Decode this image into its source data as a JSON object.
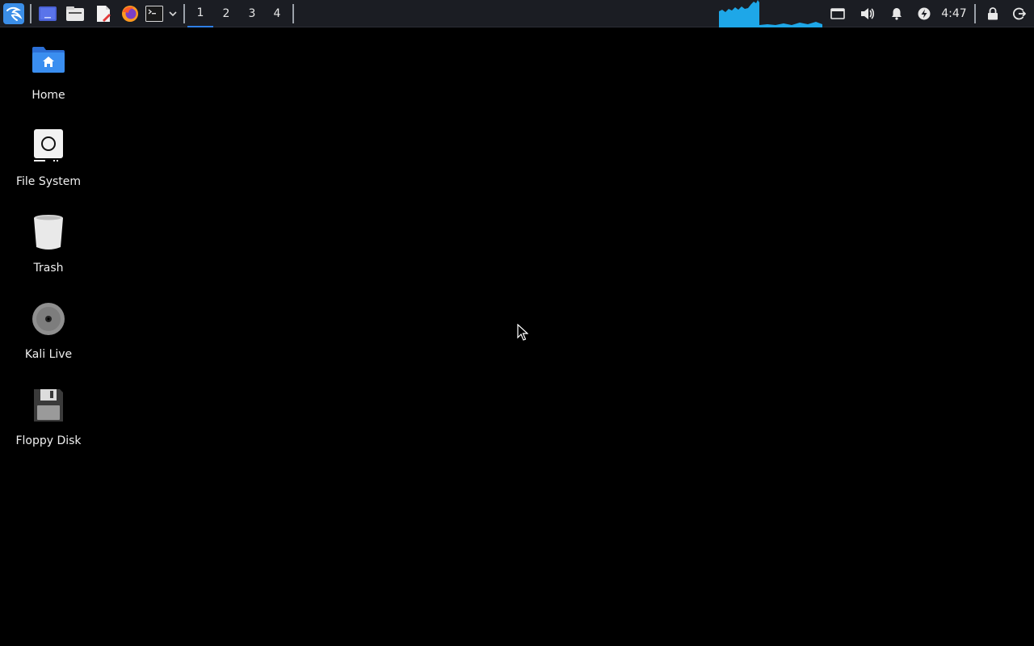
{
  "taskbar": {
    "launchers": [
      {
        "name": "kali-menu-icon"
      },
      {
        "name": "show-desktop-icon"
      },
      {
        "name": "file-manager-icon"
      },
      {
        "name": "text-editor-icon"
      },
      {
        "name": "firefox-icon"
      },
      {
        "name": "terminal-icon"
      },
      {
        "name": "chevron-down-icon"
      }
    ],
    "workspaces": [
      "1",
      "2",
      "3",
      "4"
    ],
    "active_workspace": "1",
    "tray": {
      "clock": "4:47"
    }
  },
  "desktop": {
    "icons": [
      {
        "label": "Home",
        "icon": "home-folder-icon"
      },
      {
        "label": "File System",
        "icon": "file-system-icon"
      },
      {
        "label": "Trash",
        "icon": "trash-icon"
      },
      {
        "label": "Kali Live",
        "icon": "disc-icon"
      },
      {
        "label": "Floppy Disk",
        "icon": "floppy-disk-icon"
      }
    ]
  },
  "colors": {
    "panel_bg": "#1b1d23",
    "desktop_bg": "#000000",
    "accent": "#2f7fe6",
    "graph": "#1ea7e8"
  }
}
